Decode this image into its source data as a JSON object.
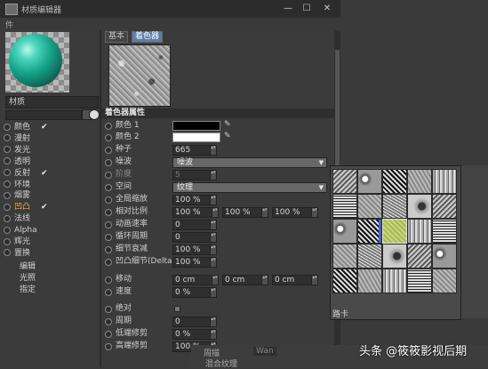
{
  "window": {
    "title": "材质编辑器",
    "controls": [
      "—",
      "☐",
      "✕"
    ]
  },
  "menubar": {
    "label": "件"
  },
  "left_panel": {
    "material_name": "材质",
    "channels": [
      {
        "label": "颜色",
        "checked": true,
        "highlight": false
      },
      {
        "label": "漫射",
        "checked": false,
        "highlight": false
      },
      {
        "label": "发光",
        "checked": false,
        "highlight": false
      },
      {
        "label": "透明",
        "checked": false,
        "highlight": false
      },
      {
        "label": "反射",
        "checked": true,
        "highlight": false
      },
      {
        "label": "环境",
        "checked": false,
        "highlight": false
      },
      {
        "label": "烟雾",
        "checked": false,
        "highlight": false
      },
      {
        "label": "凹凸",
        "checked": true,
        "highlight": true
      },
      {
        "label": "法线",
        "checked": false,
        "highlight": false
      },
      {
        "label": "Alpha",
        "checked": false,
        "highlight": false
      },
      {
        "label": "辉光",
        "checked": false,
        "highlight": false
      },
      {
        "label": "置换",
        "checked": false,
        "highlight": false
      }
    ],
    "sub_items": [
      "编辑",
      "光照",
      "指定"
    ]
  },
  "tabs": [
    {
      "label": "基本",
      "active": false
    },
    {
      "label": "着色器",
      "active": true
    }
  ],
  "section_title": "着色器属性",
  "props": {
    "color1": {
      "label": "颜色 1",
      "color": "#000000"
    },
    "color2": {
      "label": "颜色 2",
      "color": "#ffffff"
    },
    "seed": {
      "label": "种子",
      "value": "665"
    },
    "noise": {
      "label": "噪波",
      "value": "噪波"
    },
    "octaves": {
      "label": "阶度",
      "value": "5"
    },
    "space": {
      "label": "空间",
      "value": "纹理"
    },
    "global_scale": {
      "label": "全局缩放",
      "value": "100 %"
    },
    "relative_scale": {
      "label": "相对比例",
      "values": [
        "100 %",
        "100 %",
        "100 %"
      ]
    },
    "anim_speed": {
      "label": "动画速率",
      "value": "0"
    },
    "loop_period": {
      "label": "循环周期",
      "value": "0"
    },
    "detail_atten": {
      "label": "细节衰减",
      "value": "100 %"
    },
    "delta": {
      "label": "凹凸细节(Delta)",
      "value": "100 %"
    },
    "move": {
      "label": "移动",
      "values": [
        "0 cm",
        "0 cm",
        "0 cm"
      ]
    },
    "speed": {
      "label": "速度",
      "value": "0 %"
    },
    "absolute": {
      "label": "绝对"
    },
    "period": {
      "label": "周期",
      "value": "0"
    },
    "low_clip": {
      "label": "低端修剪",
      "value": "0 %"
    },
    "high_clip": {
      "label": "高端修剪",
      "value": "100 %"
    }
  },
  "popup": {
    "label": "路卡"
  },
  "bottom": {
    "left": "周描",
    "mid": "Wan",
    "second": "混合纹理"
  },
  "watermark": "头条 @筱筱影视后期"
}
